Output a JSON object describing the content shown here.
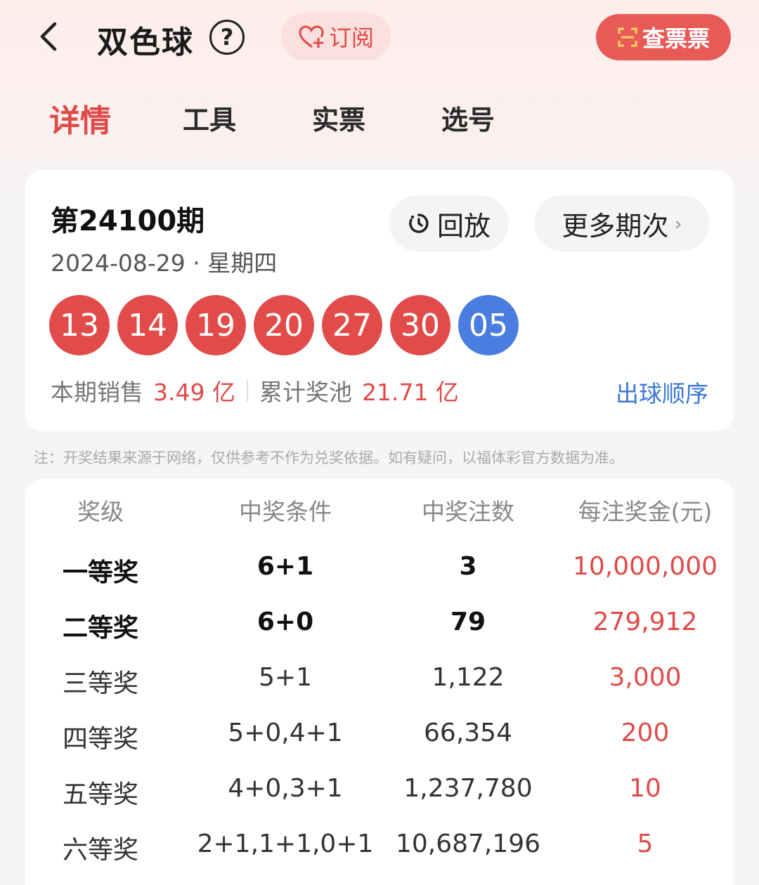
{
  "header": {
    "title": "双色球",
    "help_label": "?",
    "subscribe_label": "订阅",
    "check_ticket_label": "查票票"
  },
  "tabs": [
    {
      "label": "详情",
      "active": true
    },
    {
      "label": "工具",
      "active": false
    },
    {
      "label": "实票",
      "active": false
    },
    {
      "label": "选号",
      "active": false
    }
  ],
  "draw": {
    "issue": "第24100期",
    "date": "2024-08-29 · 星期四",
    "replay_label": "回放",
    "more_label": "更多期次",
    "red_balls": [
      "13",
      "14",
      "19",
      "20",
      "27",
      "30"
    ],
    "blue_ball": "05",
    "sales_label": "本期销售",
    "sales_value": "3.49 亿",
    "pool_label": "累计奖池",
    "pool_value": "21.71 亿",
    "order_label": "出球顺序"
  },
  "note": "注：开奖结果来源于网络，仅供参考不作为兑奖依据。如有疑问，以福体彩官方数据为准。",
  "prize_table": {
    "headers": [
      "奖级",
      "中奖条件",
      "中奖注数",
      "每注奖金(元)"
    ],
    "rows": [
      {
        "level": "一等奖",
        "condition": "6+1",
        "count": "3",
        "amount": "10,000,000"
      },
      {
        "level": "二等奖",
        "condition": "6+0",
        "count": "79",
        "amount": "279,912"
      },
      {
        "level": "三等奖",
        "condition": "5+1",
        "count": "1,122",
        "amount": "3,000"
      },
      {
        "level": "四等奖",
        "condition": "5+0,4+1",
        "count": "66,354",
        "amount": "200"
      },
      {
        "level": "五等奖",
        "condition": "4+0,3+1",
        "count": "1,237,780",
        "amount": "10"
      },
      {
        "level": "六等奖",
        "condition": "2+1,1+1,0+1",
        "count": "10,687,196",
        "amount": "5"
      }
    ]
  },
  "colors": {
    "accent_red": "#e04a48",
    "ball_red": "#e14c4a",
    "ball_blue": "#4a7de0",
    "link_blue": "#3b78d6"
  }
}
